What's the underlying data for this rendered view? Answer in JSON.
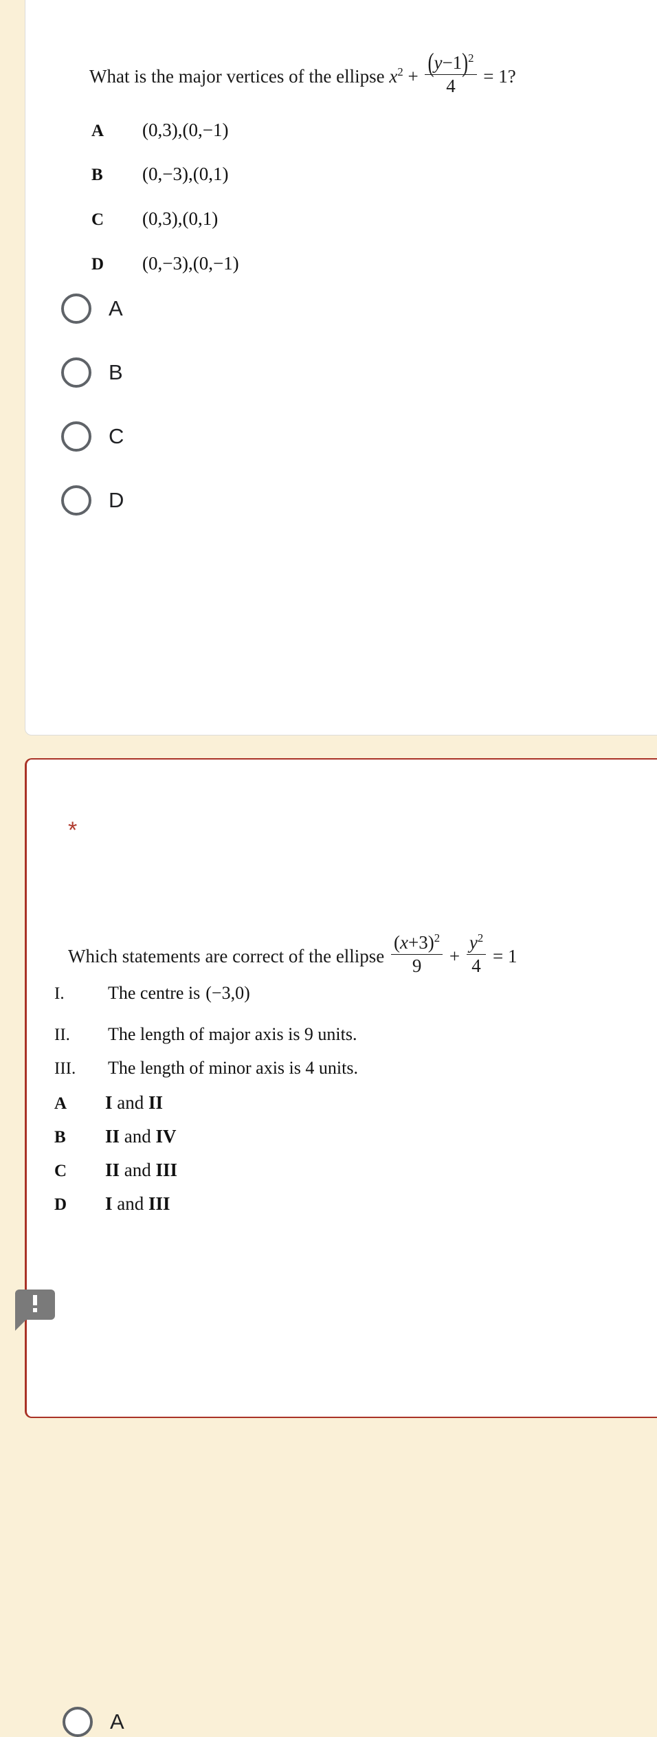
{
  "theme": {
    "page_bg": "#faf0d7",
    "card_bg": "#ffffff",
    "card_border": "#dcdcda",
    "required_border": "#a93226",
    "asterisk_color": "#b03a2e",
    "radio_ring": "#5f6368",
    "badge_bg": "#7a7a7a"
  },
  "question1": {
    "prompt_lead": "What is the major vertices of the ellipse",
    "math": {
      "term1_base": "x",
      "term1_exp": "2",
      "plus": "+",
      "frac_num_open": "(",
      "frac_num_var": "y",
      "frac_num_minus": "−1",
      "frac_num_close": ")",
      "frac_num_exp": "2",
      "frac_den": "4",
      "equals": "= 1",
      "question_mark": "?"
    },
    "options": [
      {
        "letter": "A",
        "value": "(0,3),(0,−1)"
      },
      {
        "letter": "B",
        "value": "(0,−3),(0,1)"
      },
      {
        "letter": "C",
        "value": "(0,3),(0,1)"
      },
      {
        "letter": "D",
        "value": "(0,−3),(0,−1)"
      }
    ],
    "choices": [
      {
        "label": "A",
        "selected": false
      },
      {
        "label": "B",
        "selected": false
      },
      {
        "label": "C",
        "selected": false
      },
      {
        "label": "D",
        "selected": false
      }
    ]
  },
  "question2": {
    "required_marker": "*",
    "prompt_lead": "Which statements are correct of the ellipse",
    "math": {
      "frac1_num_open": "(",
      "frac1_num_var": "x",
      "frac1_num_plus": "+3",
      "frac1_num_close": ")",
      "frac1_num_exp": "2",
      "frac1_den": "9",
      "plus": "+",
      "frac2_num_var": "y",
      "frac2_num_exp": "2",
      "frac2_den": "4",
      "equals": "= 1"
    },
    "statements": [
      {
        "numeral": "I.",
        "text_lead": "The centre is",
        "text_math": "(−3,0)"
      },
      {
        "numeral": "II.",
        "text_lead": "The length of major axis is 9 units.",
        "text_math": ""
      },
      {
        "numeral": "III.",
        "text_lead": "The length of minor axis is 4 units.",
        "text_math": ""
      }
    ],
    "options": [
      {
        "letter": "A",
        "part1": "I",
        "join": " and ",
        "part2": "II"
      },
      {
        "letter": "B",
        "part1": "II",
        "join": " and ",
        "part2": "IV"
      },
      {
        "letter": "C",
        "part1": "II",
        "join": " and ",
        "part2": "III"
      },
      {
        "letter": "D",
        "part1": "I",
        "join": " and ",
        "part2": "III"
      }
    ],
    "choices": [
      {
        "label": "A",
        "selected": false
      }
    ],
    "badge": {
      "icon": "exclamation-icon"
    }
  }
}
